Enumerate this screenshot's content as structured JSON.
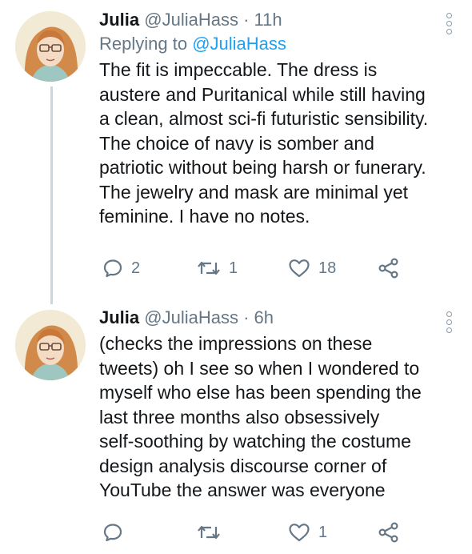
{
  "tweets": [
    {
      "name": "Julia",
      "handle": "@JuliaHass",
      "separator": "·",
      "time": "11h",
      "replying_prefix": "Replying to",
      "replying_to": "@JuliaHass",
      "lines": [
        "The fit is impeccable. The dress is",
        "austere and Puritanical while still having",
        "a clean, almost sci-fi futuristic sensibility.",
        "The choice of navy is somber and",
        "patriotic without being harsh or funerary.",
        "The jewelry and mask are minimal yet",
        "feminine. I have no notes."
      ],
      "replies": "2",
      "retweets": "1",
      "likes": "18"
    },
    {
      "name": "Julia",
      "handle": "@JuliaHass",
      "separator": "·",
      "time": "6h",
      "lines": [
        "(checks the impressions on these",
        "tweets) oh I see so when I wondered to",
        "myself who else has been spending the",
        "last three months also obsessively",
        "self-soothing by watching the costume",
        "design analysis discourse corner of",
        "YouTube the answer was everyone"
      ],
      "replies": "",
      "retweets": "",
      "likes": "1"
    }
  ],
  "icons": {
    "reply": "reply-icon",
    "retweet": "retweet-icon",
    "like": "heart-icon",
    "share": "share-icon",
    "more": "more-vertical-icon"
  },
  "colors": {
    "text": "#14171a",
    "secondary": "#657786",
    "link": "#1da1f2",
    "thread_line": "#ccd6dd"
  }
}
